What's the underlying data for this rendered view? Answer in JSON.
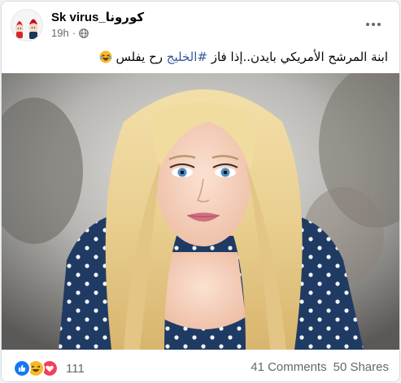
{
  "post": {
    "page_name": "Sk virus_كورونا",
    "timestamp": "19h",
    "meta_separator": "·",
    "audience_icon": "globe-icon",
    "more_icon": "more-options-icon",
    "caption_text": "ابنة المرشح الأمريكي بايدن..إذا فاز ",
    "caption_hashtag": "#الخليج",
    "caption_tail": " رح يفلس ",
    "caption_emoji": "laughing-tears-emoji"
  },
  "footer": {
    "reaction_icons": [
      "like-reaction-icon",
      "haha-reaction-icon",
      "love-reaction-icon"
    ],
    "reaction_count": "111",
    "comments": "41 Comments",
    "shares": "50 Shares"
  },
  "colors": {
    "link": "#385898",
    "text": "#050505",
    "secondary_text": "#65676b",
    "like_blue": "#1877f2",
    "love_red": "#f33e58",
    "haha_yellow": "#f7b928"
  }
}
